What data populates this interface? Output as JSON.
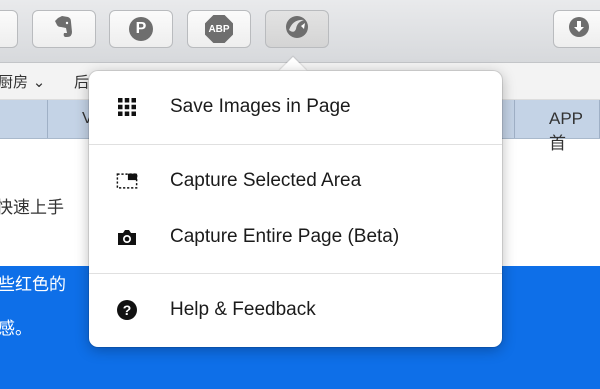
{
  "toolbar": {
    "buttons": [
      {
        "icon": "evernote-icon"
      },
      {
        "icon": "pinterest-icon",
        "glyph": "P"
      },
      {
        "icon": "adblock-plus-icon",
        "glyph": "ABP"
      },
      {
        "icon": "screenshot-extension-icon"
      },
      {
        "icon": "download-icon"
      }
    ]
  },
  "nav": {
    "item_1": "厨房 ⌄",
    "item_2": "后"
  },
  "tabs": {
    "tab_fragment_left": "V",
    "tab_right": "APP首"
  },
  "page": {
    "line_1": "快速上手",
    "line_2": "些红色的",
    "line_3": "感。"
  },
  "menu": {
    "items": [
      {
        "label": "Save Images in Page",
        "icon": "grid-icon"
      },
      {
        "label": "Capture Selected Area",
        "icon": "selection-area-icon"
      },
      {
        "label": "Capture Entire Page (Beta)",
        "icon": "camera-icon"
      },
      {
        "label": "Help & Feedback",
        "icon": "help-icon"
      }
    ]
  }
}
